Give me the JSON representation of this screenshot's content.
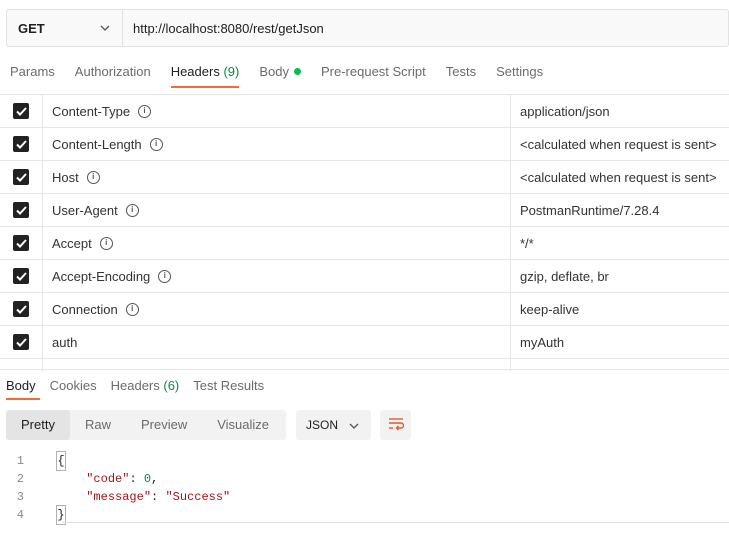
{
  "request": {
    "method": "GET",
    "url": "http://localhost:8080/rest/getJson"
  },
  "request_tabs": [
    {
      "label": "Params"
    },
    {
      "label": "Authorization"
    },
    {
      "label": "Headers",
      "count": "(9)",
      "active": true
    },
    {
      "label": "Body",
      "dot": true
    },
    {
      "label": "Pre-request Script"
    },
    {
      "label": "Tests"
    },
    {
      "label": "Settings"
    }
  ],
  "headers": [
    {
      "key": "Content-Type",
      "value": "application/json",
      "info": true,
      "checked": true
    },
    {
      "key": "Content-Length",
      "value": "<calculated when request is sent>",
      "info": true,
      "checked": true
    },
    {
      "key": "Host",
      "value": "<calculated when request is sent>",
      "info": true,
      "checked": true
    },
    {
      "key": "User-Agent",
      "value": "PostmanRuntime/7.28.4",
      "info": true,
      "checked": true
    },
    {
      "key": "Accept",
      "value": "*/*",
      "info": true,
      "checked": true
    },
    {
      "key": "Accept-Encoding",
      "value": "gzip, deflate, br",
      "info": true,
      "checked": true
    },
    {
      "key": "Connection",
      "value": "keep-alive",
      "info": true,
      "checked": true
    },
    {
      "key": "auth",
      "value": "myAuth",
      "info": false,
      "checked": true
    }
  ],
  "response_tabs": [
    {
      "label": "Body",
      "active": true
    },
    {
      "label": "Cookies"
    },
    {
      "label": "Headers",
      "count": "(6)"
    },
    {
      "label": "Test Results"
    }
  ],
  "view_modes": [
    {
      "label": "Pretty",
      "active": true
    },
    {
      "label": "Raw"
    },
    {
      "label": "Preview"
    },
    {
      "label": "Visualize"
    }
  ],
  "format": "JSON",
  "code_lines": [
    {
      "num": "1",
      "text": "{"
    },
    {
      "num": "2",
      "key": "\"code\"",
      "value": "0",
      "value_type": "number"
    },
    {
      "num": "3",
      "key": "\"message\"",
      "value": "\"Success\"",
      "value_type": "string"
    },
    {
      "num": "4",
      "text": "}"
    }
  ],
  "colors": {
    "accent": "#f26b3a",
    "count_green": "#0c8a41",
    "status_dot": "#0cbb52"
  }
}
